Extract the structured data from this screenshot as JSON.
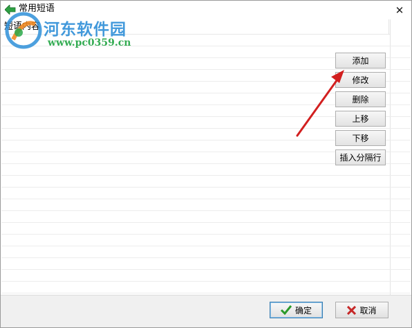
{
  "window": {
    "title": "常用短语",
    "close_label": "✕"
  },
  "list": {
    "column_header": "短语内容",
    "row_count": 22
  },
  "side_buttons": [
    {
      "id": "add",
      "label": "添加"
    },
    {
      "id": "edit",
      "label": "修改"
    },
    {
      "id": "delete",
      "label": "删除"
    },
    {
      "id": "move-up",
      "label": "上移"
    },
    {
      "id": "move-down",
      "label": "下移"
    },
    {
      "id": "insert-separator",
      "label": "插入分隔行"
    }
  ],
  "footer": {
    "ok_label": "确定",
    "cancel_label": "取消"
  },
  "watermark": {
    "name": "河东软件园",
    "url": "www.pc0359.cn"
  },
  "colors": {
    "accent": "#2e8fd8",
    "ok_check": "#2a9a2a",
    "cancel_x": "#c62828",
    "arrow": "#d21f1f"
  },
  "icons": {
    "title": "back-arrow-icon",
    "ok": "check-icon",
    "cancel": "x-icon"
  }
}
